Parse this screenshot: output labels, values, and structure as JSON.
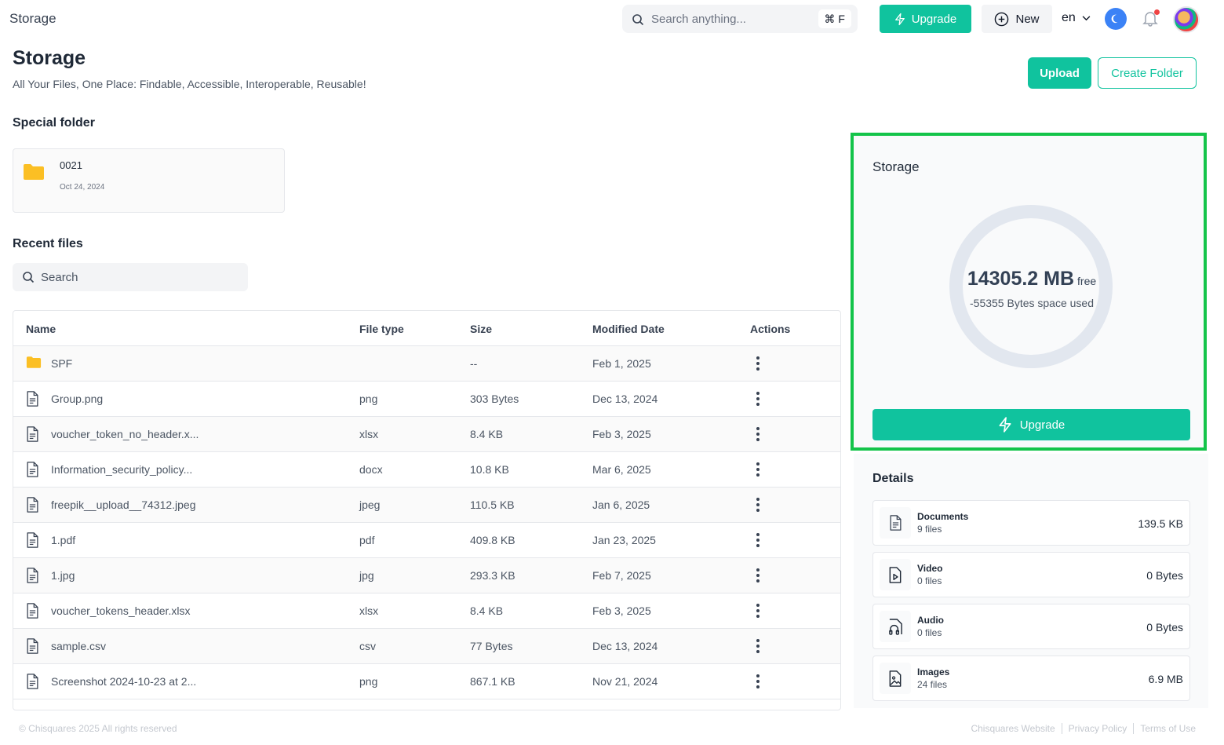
{
  "topbar": {
    "app_title": "Storage",
    "search_placeholder": "Search anything...",
    "search_shortcut": "⌘ F",
    "upgrade_label": "Upgrade",
    "new_label": "New",
    "language": "en"
  },
  "page": {
    "title": "Storage",
    "subtitle": "All Your Files, One Place: Findable, Accessible, Interoperable, Reusable!",
    "upload_label": "Upload",
    "create_folder_label": "Create Folder"
  },
  "special_folder": {
    "heading": "Special folder",
    "folder": {
      "name": "0021",
      "date": "Oct 24, 2024"
    }
  },
  "recent_files": {
    "heading": "Recent files",
    "search_placeholder": "Search",
    "columns": {
      "name": "Name",
      "type": "File type",
      "size": "Size",
      "date": "Modified Date",
      "actions": "Actions"
    },
    "rows": [
      {
        "icon": "folder-icon",
        "name": "SPF",
        "type": "",
        "size": "--",
        "date": "Feb 1, 2025"
      },
      {
        "icon": "document-icon",
        "name": "Group.png",
        "type": "png",
        "size": "303 Bytes",
        "date": "Dec 13, 2024"
      },
      {
        "icon": "document-icon",
        "name": "voucher_token_no_header.x...",
        "type": "xlsx",
        "size": "8.4 KB",
        "date": "Feb 3, 2025"
      },
      {
        "icon": "document-icon",
        "name": "Information_security_policy...",
        "type": "docx",
        "size": "10.8 KB",
        "date": "Mar 6, 2025"
      },
      {
        "icon": "document-icon",
        "name": "freepik__upload__74312.jpeg",
        "type": "jpeg",
        "size": "110.5 KB",
        "date": "Jan 6, 2025"
      },
      {
        "icon": "document-icon",
        "name": "1.pdf",
        "type": "pdf",
        "size": "409.8 KB",
        "date": "Jan 23, 2025"
      },
      {
        "icon": "document-icon",
        "name": "1.jpg",
        "type": "jpg",
        "size": "293.3 KB",
        "date": "Feb 7, 2025"
      },
      {
        "icon": "document-icon",
        "name": "voucher_tokens_header.xlsx",
        "type": "xlsx",
        "size": "8.4 KB",
        "date": "Feb 3, 2025"
      },
      {
        "icon": "document-icon",
        "name": "sample.csv",
        "type": "csv",
        "size": "77 Bytes",
        "date": "Dec 13, 2024"
      },
      {
        "icon": "document-icon",
        "name": "Screenshot 2024-10-23 at 2...",
        "type": "png",
        "size": "867.1 KB",
        "date": "Nov 21, 2024"
      }
    ]
  },
  "storage_panel": {
    "title": "Storage",
    "free_value": "14305.2 MB",
    "free_label": "free",
    "used_text": "-55355 Bytes space used",
    "upgrade_label": "Upgrade"
  },
  "details": {
    "title": "Details",
    "items": [
      {
        "icon": "document-icon",
        "name": "Documents",
        "count": "9 files",
        "size": "139.5 KB"
      },
      {
        "icon": "video-icon",
        "name": "Video",
        "count": "0 files",
        "size": "0 Bytes"
      },
      {
        "icon": "audio-icon",
        "name": "Audio",
        "count": "0 files",
        "size": "0 Bytes"
      },
      {
        "icon": "image-icon",
        "name": "Images",
        "count": "24 files",
        "size": "6.9 MB"
      }
    ]
  },
  "footer": {
    "copyright": "© Chisquares 2025 All rights reserved",
    "links": [
      "Chisquares Website",
      "Privacy Policy",
      "Terms of Use"
    ]
  },
  "colors": {
    "accent": "#10c39e",
    "highlight_border": "#14c44a",
    "folder": "#fbbf24"
  }
}
